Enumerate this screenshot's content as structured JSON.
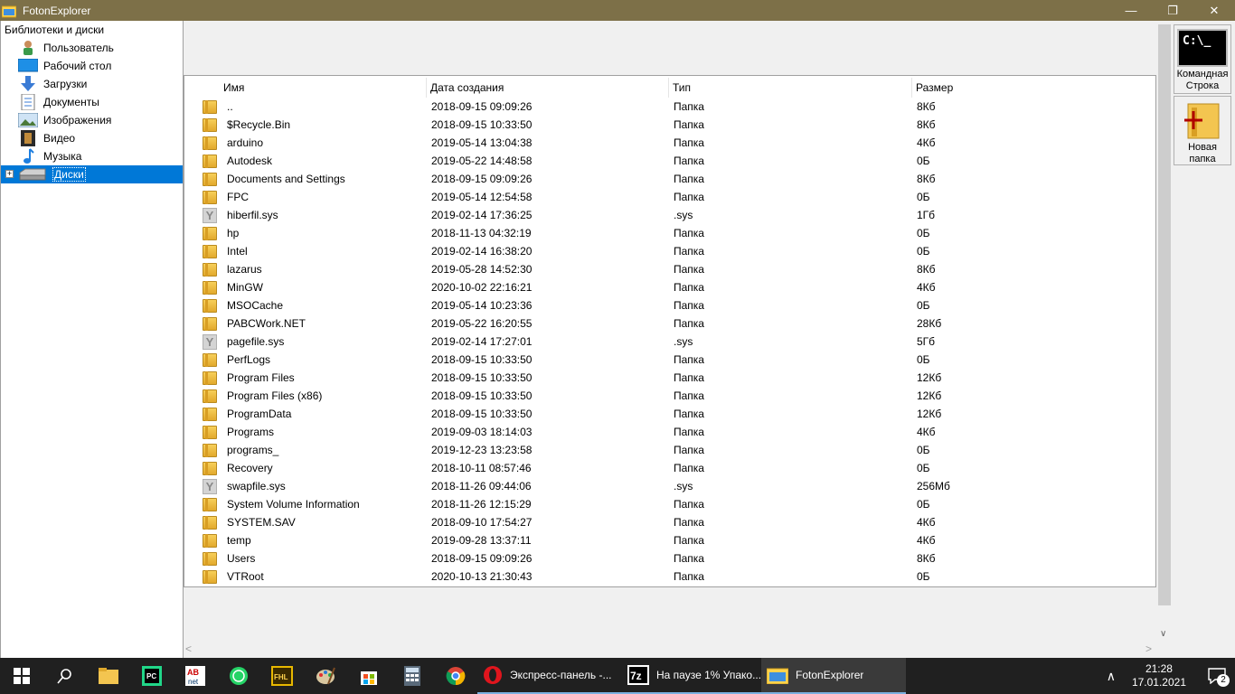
{
  "window": {
    "title": "FotonExplorer"
  },
  "tree": {
    "root_label": "Библиотеки и диски",
    "items": [
      {
        "label": "Пользователь",
        "icon": "user-icon"
      },
      {
        "label": "Рабочий стол",
        "icon": "desktop-icon"
      },
      {
        "label": "Загрузки",
        "icon": "download-arrow-icon"
      },
      {
        "label": "Документы",
        "icon": "document-icon"
      },
      {
        "label": "Изображения",
        "icon": "image-icon"
      },
      {
        "label": "Видео",
        "icon": "film-icon"
      },
      {
        "label": "Музыка",
        "icon": "music-note-icon"
      },
      {
        "label": "Диски",
        "icon": "drive-icon",
        "selected": true,
        "expander": "+"
      }
    ]
  },
  "filelist": {
    "columns": [
      "Имя",
      "Дата создания",
      "Тип",
      "Размер"
    ],
    "rows": [
      {
        "name": "..",
        "date": "2018-09-15 09:09:26",
        "type": "Папка",
        "size": "8Кб",
        "kind": "folder"
      },
      {
        "name": "$Recycle.Bin",
        "date": "2018-09-15 10:33:50",
        "type": "Папка",
        "size": "8Кб",
        "kind": "folder"
      },
      {
        "name": "arduino",
        "date": "2019-05-14 13:04:38",
        "type": "Папка",
        "size": "4Кб",
        "kind": "folder"
      },
      {
        "name": "Autodesk",
        "date": "2019-05-22 14:48:58",
        "type": "Папка",
        "size": "0Б",
        "kind": "folder"
      },
      {
        "name": "Documents and Settings",
        "date": "2018-09-15 09:09:26",
        "type": "Папка",
        "size": "8Кб",
        "kind": "folder"
      },
      {
        "name": "FPC",
        "date": "2019-05-14 12:54:58",
        "type": "Папка",
        "size": "0Б",
        "kind": "folder"
      },
      {
        "name": "hiberfil.sys",
        "date": "2019-02-14 17:36:25",
        "type": ".sys",
        "size": "1Гб",
        "kind": "sys"
      },
      {
        "name": "hp",
        "date": "2018-11-13 04:32:19",
        "type": "Папка",
        "size": "0Б",
        "kind": "folder"
      },
      {
        "name": "Intel",
        "date": "2019-02-14 16:38:20",
        "type": "Папка",
        "size": "0Б",
        "kind": "folder"
      },
      {
        "name": "lazarus",
        "date": "2019-05-28 14:52:30",
        "type": "Папка",
        "size": "8Кб",
        "kind": "folder"
      },
      {
        "name": "MinGW",
        "date": "2020-10-02 22:16:21",
        "type": "Папка",
        "size": "4Кб",
        "kind": "folder"
      },
      {
        "name": "MSOCache",
        "date": "2019-05-14 10:23:36",
        "type": "Папка",
        "size": "0Б",
        "kind": "folder"
      },
      {
        "name": "PABCWork.NET",
        "date": "2019-05-22 16:20:55",
        "type": "Папка",
        "size": "28Кб",
        "kind": "folder"
      },
      {
        "name": "pagefile.sys",
        "date": "2019-02-14 17:27:01",
        "type": ".sys",
        "size": "5Гб",
        "kind": "sys"
      },
      {
        "name": "PerfLogs",
        "date": "2018-09-15 10:33:50",
        "type": "Папка",
        "size": "0Б",
        "kind": "folder"
      },
      {
        "name": "Program Files",
        "date": "2018-09-15 10:33:50",
        "type": "Папка",
        "size": "12Кб",
        "kind": "folder"
      },
      {
        "name": "Program Files (x86)",
        "date": "2018-09-15 10:33:50",
        "type": "Папка",
        "size": "12Кб",
        "kind": "folder"
      },
      {
        "name": "ProgramData",
        "date": "2018-09-15 10:33:50",
        "type": "Папка",
        "size": "12Кб",
        "kind": "folder"
      },
      {
        "name": "Programs",
        "date": "2019-09-03 18:14:03",
        "type": "Папка",
        "size": "4Кб",
        "kind": "folder"
      },
      {
        "name": "programs_",
        "date": "2019-12-23 13:23:58",
        "type": "Папка",
        "size": "0Б",
        "kind": "folder"
      },
      {
        "name": "Recovery",
        "date": "2018-10-11 08:57:46",
        "type": "Папка",
        "size": "0Б",
        "kind": "folder"
      },
      {
        "name": "swapfile.sys",
        "date": "2018-11-26 09:44:06",
        "type": ".sys",
        "size": "256Мб",
        "kind": "sys"
      },
      {
        "name": "System Volume Information",
        "date": "2018-11-26 12:15:29",
        "type": "Папка",
        "size": "0Б",
        "kind": "folder"
      },
      {
        "name": "SYSTEM.SAV",
        "date": "2018-09-10 17:54:27",
        "type": "Папка",
        "size": "4Кб",
        "kind": "folder"
      },
      {
        "name": "temp",
        "date": "2019-09-28 13:37:11",
        "type": "Папка",
        "size": "4Кб",
        "kind": "folder"
      },
      {
        "name": "Users",
        "date": "2018-09-15 09:09:26",
        "type": "Папка",
        "size": "8Кб",
        "kind": "folder"
      },
      {
        "name": "VTRoot",
        "date": "2020-10-13 21:30:43",
        "type": "Папка",
        "size": "0Б",
        "kind": "folder"
      }
    ]
  },
  "tools": {
    "cmd_label": "Командная Строка",
    "cmd_glyph": "C:\\_",
    "new_folder_label": "Новая папка"
  },
  "taskbar": {
    "apps": [
      {
        "label": "Экспресс-панель -...",
        "icon": "opera-icon"
      },
      {
        "label": "На паузе 1% Упако...",
        "icon": "7zip-icon"
      },
      {
        "label": "FotonExplorer",
        "icon": "fotonexplorer-icon"
      }
    ],
    "time": "21:28",
    "date": "17.01.2021",
    "notification_count": "2"
  },
  "colors": {
    "titlebar": "#7d7048",
    "selection": "#0078d7",
    "taskbar": "#202020",
    "folder": "#e8b43a"
  }
}
